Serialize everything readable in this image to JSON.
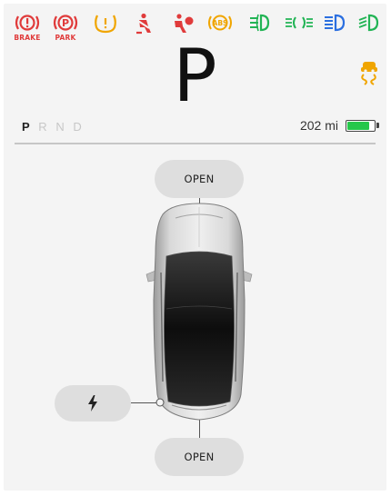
{
  "telltales": [
    {
      "name": "brake-warning-icon",
      "label": "BRAKE",
      "color": "#e03b3b"
    },
    {
      "name": "park-brake-icon",
      "label": "PARK",
      "color": "#e03b3b"
    },
    {
      "name": "tire-pressure-icon",
      "label": "",
      "color": "#f0a500"
    },
    {
      "name": "seatbelt-icon",
      "label": "",
      "color": "#e03b3b"
    },
    {
      "name": "airbag-icon",
      "label": "",
      "color": "#e03b3b"
    },
    {
      "name": "abs-icon",
      "label": "",
      "color": "#f0a500"
    },
    {
      "name": "front-fog-light-icon",
      "label": "",
      "color": "#22b455"
    },
    {
      "name": "parking-lights-icon",
      "label": "",
      "color": "#22b455"
    },
    {
      "name": "high-beam-icon",
      "label": "",
      "color": "#2b6fe0"
    },
    {
      "name": "low-beam-icon",
      "label": "",
      "color": "#22b455"
    }
  ],
  "gear": {
    "current": "P",
    "options": [
      "P",
      "R",
      "N",
      "D"
    ],
    "active": "P"
  },
  "range": {
    "text": "202 mi",
    "battery_level": 0.85,
    "battery_color": "#25c74a"
  },
  "traction_icon": {
    "name": "traction-control-icon",
    "color": "#f0a500"
  },
  "controls": {
    "frunk_label": "OPEN",
    "trunk_label": "OPEN",
    "charge_port_icon": "lightning-icon"
  },
  "car": {
    "color": "silver",
    "view": "top-down"
  }
}
